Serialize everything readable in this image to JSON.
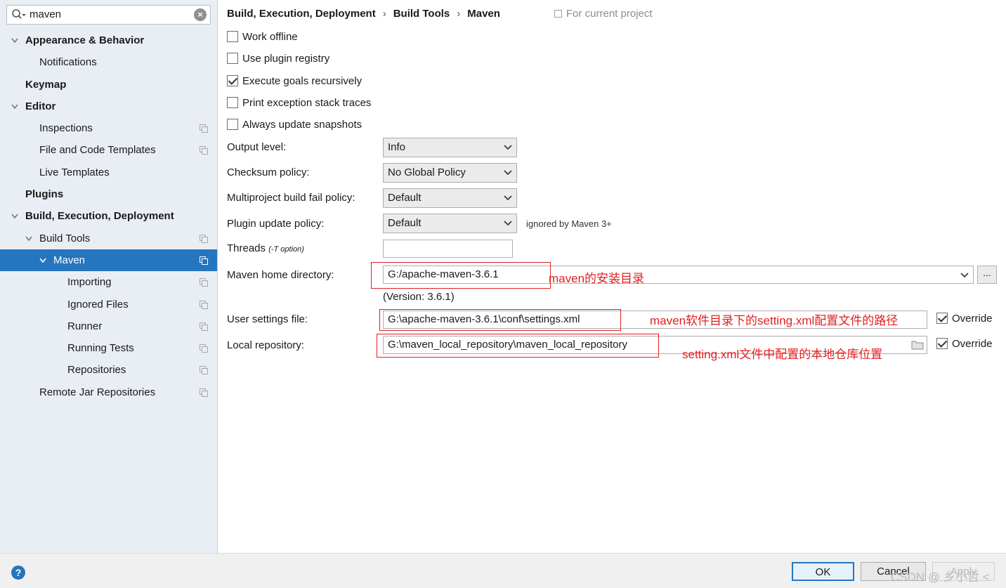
{
  "search": {
    "value": "maven"
  },
  "tree": [
    {
      "label": "Appearance & Behavior",
      "bold": true,
      "level": 0,
      "expandable": true,
      "expanded": true,
      "copy": false,
      "selected": false
    },
    {
      "label": "Notifications",
      "bold": false,
      "level": 1,
      "expandable": false,
      "expanded": false,
      "copy": false,
      "selected": false
    },
    {
      "label": "Keymap",
      "bold": true,
      "level": 0,
      "expandable": false,
      "expanded": false,
      "copy": false,
      "selected": false
    },
    {
      "label": "Editor",
      "bold": true,
      "level": 0,
      "expandable": true,
      "expanded": true,
      "copy": false,
      "selected": false
    },
    {
      "label": "Inspections",
      "bold": false,
      "level": 1,
      "expandable": false,
      "expanded": false,
      "copy": true,
      "selected": false
    },
    {
      "label": "File and Code Templates",
      "bold": false,
      "level": 1,
      "expandable": false,
      "expanded": false,
      "copy": true,
      "selected": false
    },
    {
      "label": "Live Templates",
      "bold": false,
      "level": 1,
      "expandable": false,
      "expanded": false,
      "copy": false,
      "selected": false
    },
    {
      "label": "Plugins",
      "bold": true,
      "level": 0,
      "expandable": false,
      "expanded": false,
      "copy": false,
      "selected": false
    },
    {
      "label": "Build, Execution, Deployment",
      "bold": true,
      "level": 0,
      "expandable": true,
      "expanded": true,
      "copy": false,
      "selected": false
    },
    {
      "label": "Build Tools",
      "bold": false,
      "level": 1,
      "expandable": true,
      "expanded": true,
      "copy": true,
      "selected": false
    },
    {
      "label": "Maven",
      "bold": false,
      "level": 2,
      "expandable": true,
      "expanded": true,
      "copy": true,
      "selected": true
    },
    {
      "label": "Importing",
      "bold": false,
      "level": 3,
      "expandable": false,
      "expanded": false,
      "copy": true,
      "selected": false
    },
    {
      "label": "Ignored Files",
      "bold": false,
      "level": 3,
      "expandable": false,
      "expanded": false,
      "copy": true,
      "selected": false
    },
    {
      "label": "Runner",
      "bold": false,
      "level": 3,
      "expandable": false,
      "expanded": false,
      "copy": true,
      "selected": false
    },
    {
      "label": "Running Tests",
      "bold": false,
      "level": 3,
      "expandable": false,
      "expanded": false,
      "copy": true,
      "selected": false
    },
    {
      "label": "Repositories",
      "bold": false,
      "level": 3,
      "expandable": false,
      "expanded": false,
      "copy": true,
      "selected": false
    },
    {
      "label": "Remote Jar Repositories",
      "bold": false,
      "level": 1,
      "expandable": false,
      "expanded": false,
      "copy": true,
      "selected": false
    }
  ],
  "breadcrumb": {
    "part1": "Build, Execution, Deployment",
    "sep": "›",
    "part2": "Build Tools",
    "part3": "Maven"
  },
  "for_project": "For current project",
  "checkboxes": [
    {
      "label": "Work offline",
      "checked": false
    },
    {
      "label": "Use plugin registry",
      "checked": false
    },
    {
      "label": "Execute goals recursively",
      "checked": true
    },
    {
      "label": "Print exception stack traces",
      "checked": false
    },
    {
      "label": "Always update snapshots",
      "checked": false
    }
  ],
  "output_level": {
    "label": "Output level:",
    "value": "Info"
  },
  "checksum_policy": {
    "label": "Checksum policy:",
    "value": "No Global Policy"
  },
  "fail_policy": {
    "label": "Multiproject build fail policy:",
    "value": "Default"
  },
  "plugin_update": {
    "label": "Plugin update policy:",
    "value": "Default",
    "note": "ignored by Maven 3+"
  },
  "threads": {
    "label": "Threads",
    "hint": "(-T option)",
    "value": ""
  },
  "maven_home": {
    "label": "Maven home directory:",
    "value": "G:/apache-maven-3.6.1",
    "browse": "...",
    "version": "(Version: 3.6.1)",
    "annotation": "maven的安装目录"
  },
  "user_settings": {
    "label": "User settings file:",
    "value": "G:\\apache-maven-3.6.1\\conf\\settings.xml",
    "override_label": "Override",
    "override_checked": true,
    "annotation": "maven软件目录下的setting.xml配置文件的路径"
  },
  "local_repo": {
    "label": "Local repository:",
    "value": "G:\\maven_local_repository\\maven_local_repository",
    "override_label": "Override",
    "override_checked": true,
    "annotation": "setting.xml文件中配置的本地仓库位置"
  },
  "footer": {
    "help": "?",
    "ok": "OK",
    "cancel": "Cancel",
    "apply": "Apply",
    "watermark": "CSDN @ 乡小哲 <"
  },
  "colors": {
    "selection": "#2675bf",
    "annotation": "#e02020",
    "sidebar_bg": "#e9eef4"
  }
}
